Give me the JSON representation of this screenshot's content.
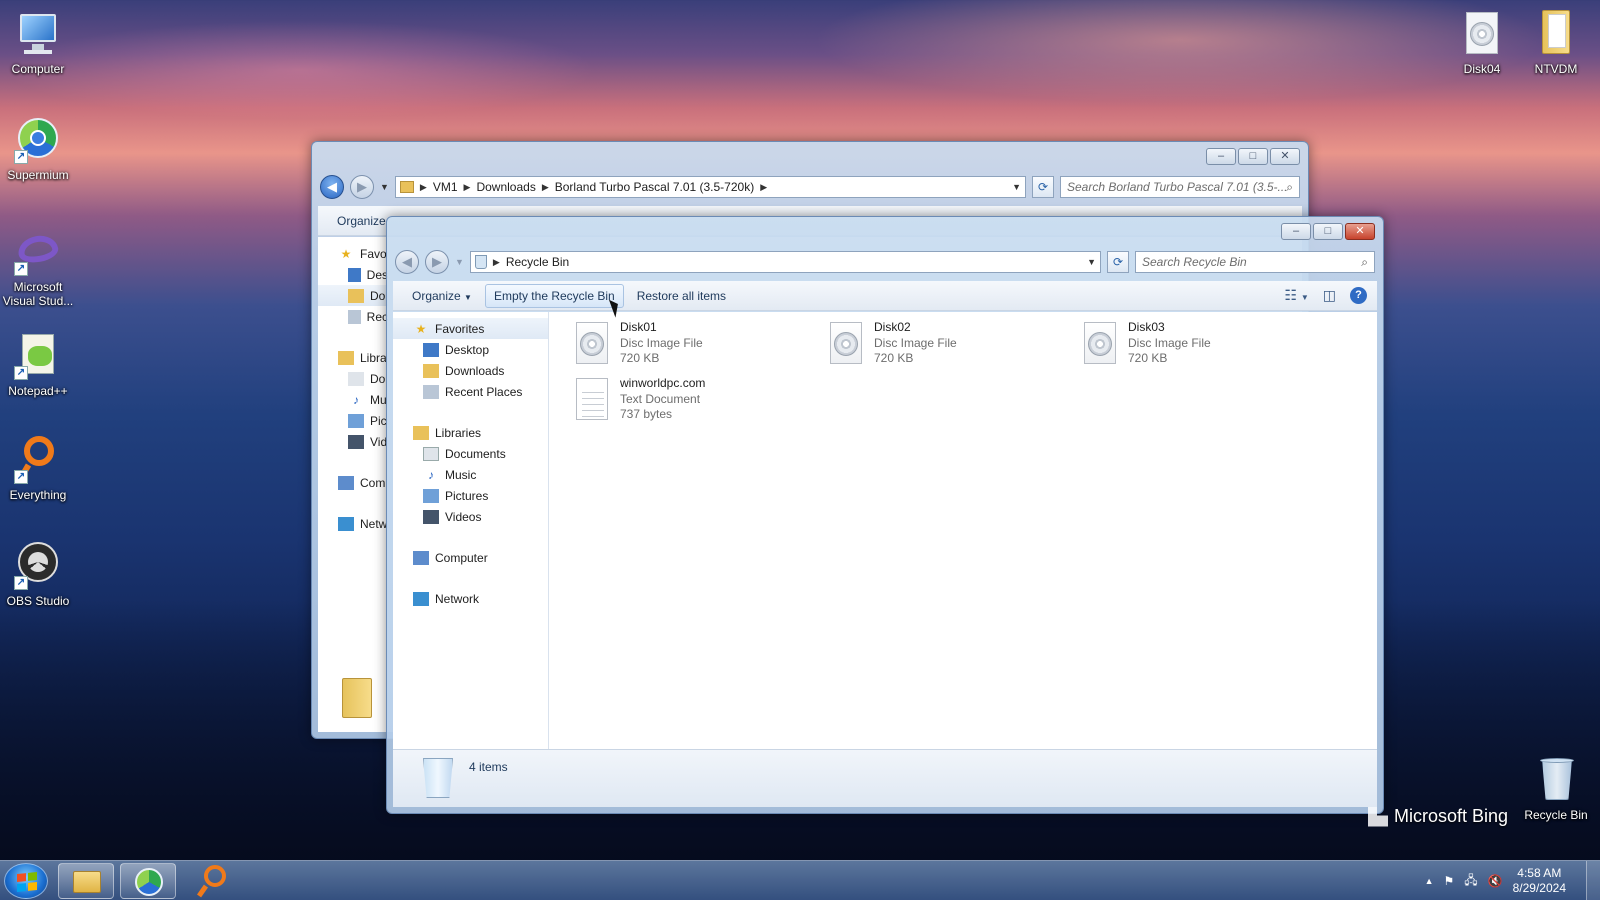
{
  "desktop": {
    "icons_left": [
      {
        "label": "Computer",
        "icon": "computer-icon"
      },
      {
        "label": "Supermium",
        "icon": "supermium-icon"
      },
      {
        "label": "Microsoft Visual Stud...",
        "icon": "visual-studio-icon"
      },
      {
        "label": "Notepad++",
        "icon": "notepad-plus-plus-icon"
      },
      {
        "label": "Everything",
        "icon": "everything-search-icon"
      },
      {
        "label": "OBS Studio",
        "icon": "obs-studio-icon"
      }
    ],
    "icons_right": [
      {
        "label": "Disk04",
        "icon": "disc-image-icon"
      },
      {
        "label": "NTVDM",
        "icon": "folder-icon"
      },
      {
        "label": "Recycle Bin",
        "icon": "recycle-bin-icon"
      }
    ],
    "watermark": "Microsoft Bing"
  },
  "back_window": {
    "breadcrumb": [
      "VM1",
      "Downloads",
      "Borland Turbo Pascal 7.01 (3.5-720k)"
    ],
    "search_placeholder": "Search Borland Turbo Pascal 7.01 (3.5-...",
    "toolbar_organize": "Organize",
    "nav_items": [
      "Favo",
      "Des",
      "Do",
      "Rec",
      "Libra",
      "Do",
      "Mu",
      "Pic",
      "Vid",
      "Com",
      "Netw"
    ]
  },
  "front_window": {
    "breadcrumb": [
      "Recycle Bin"
    ],
    "search_placeholder": "Search Recycle Bin",
    "toolbar": {
      "organize": "Organize",
      "empty": "Empty the Recycle Bin",
      "restore": "Restore all items"
    },
    "nav": {
      "favorites": "Favorites",
      "favorites_items": [
        "Desktop",
        "Downloads",
        "Recent Places"
      ],
      "libraries": "Libraries",
      "libraries_items": [
        "Documents",
        "Music",
        "Pictures",
        "Videos"
      ],
      "computer": "Computer",
      "network": "Network"
    },
    "files": [
      {
        "name": "Disk01",
        "type": "Disc Image File",
        "size": "720 KB",
        "kind": "disc"
      },
      {
        "name": "Disk02",
        "type": "Disc Image File",
        "size": "720 KB",
        "kind": "disc"
      },
      {
        "name": "Disk03",
        "type": "Disc Image File",
        "size": "720 KB",
        "kind": "disc"
      },
      {
        "name": "winworldpc.com",
        "type": "Text Document",
        "size": "737 bytes",
        "kind": "text"
      }
    ],
    "status_count": "4 items"
  },
  "taskbar": {
    "time": "4:58 AM",
    "date": "8/29/2024"
  }
}
